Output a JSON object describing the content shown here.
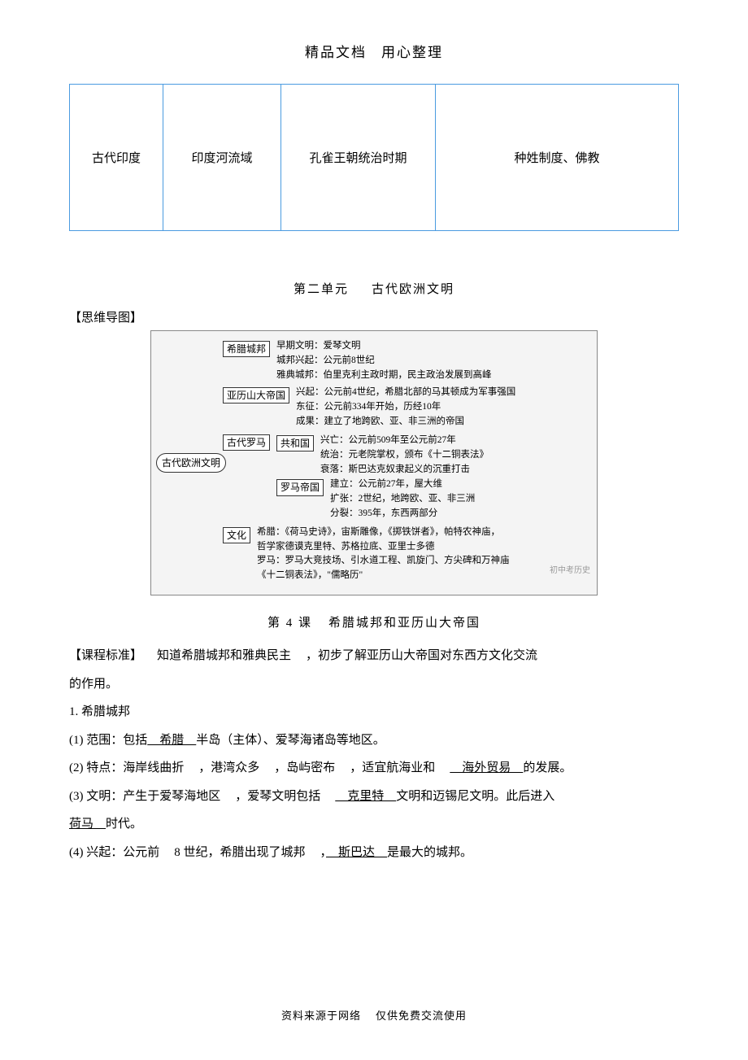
{
  "header": {
    "left": "精品文档",
    "right": "用心整理"
  },
  "table": {
    "row": {
      "c1": "古代印度",
      "c2": "印度河流域",
      "c3": "孔雀王朝统治时期",
      "c4": "种姓制度、佛教"
    }
  },
  "unit2": {
    "title_left": "第二单元",
    "title_right": "古代欧洲文明",
    "mindmap_label": "【思维导图】"
  },
  "mindmap": {
    "root": "古代欧洲文明",
    "greek": {
      "node": "希腊城邦",
      "l1": "早期文明：爱琴文明",
      "l2": "城邦兴起：公元前8世纪",
      "l3": "雅典城邦：伯里克利主政时期，民主政治发展到高峰"
    },
    "alex": {
      "node": "亚历山大帝国",
      "l1": "兴起：公元前4世纪，希腊北部的马其顿成为军事强国",
      "l2": "东征：公元前334年开始，历经10年",
      "l3": "成果：建立了地跨欧、亚、非三洲的帝国"
    },
    "rome": {
      "node": "古代罗马",
      "rep": {
        "node": "共和国",
        "l1": "兴亡：公元前509年至公元前27年",
        "l2": "统治：元老院掌权，颁布《十二铜表法》",
        "l3": "衰落：斯巴达克奴隶起义的沉重打击"
      },
      "emp": {
        "node": "罗马帝国",
        "l1": "建立：公元前27年，屋大维",
        "l2": "扩张：2世纪，地跨欧、亚、非三洲",
        "l3": "分裂：395年，东西两部分"
      }
    },
    "culture": {
      "node": "文化",
      "l1": "希腊：《荷马史诗》，宙斯雕像，《掷铁饼者》，帕特农神庙，",
      "l2": "哲学家德谟克里特、苏格拉底、亚里士多德",
      "l3": "罗马：罗马大竞技场、引水道工程、凯旋门、方尖碑和万神庙",
      "l4": "《十二铜表法》，\"儒略历\""
    },
    "watermark": "初中考历史"
  },
  "lesson4": {
    "title_left": "第 4 课",
    "title_right": "希腊城邦和亚历山大帝国",
    "std_label": "【课程标准】",
    "std_text1": "知道希腊城邦和雅典民主",
    "std_text2": "，初步了解亚历山大帝国对东西方文化交流",
    "std_text3": "的作用。",
    "p1_label": "1. 希腊城邦",
    "p1_1a": "(1) 范围：包括",
    "p1_1u": "　希腊　",
    "p1_1b": "半岛（主体）、爱琴海诸岛等地区。",
    "p1_2a": "(2) 特点：海岸线曲折",
    "p1_2b": "，港湾众多",
    "p1_2c": "，岛屿密布",
    "p1_2d": "，适宜航海业和",
    "p1_2u": "　海外贸易　",
    "p1_2e": "的发展。",
    "p1_3a": "(3) 文明：产生于爱琴海地区",
    "p1_3b": "，爱琴文明包括",
    "p1_3u": "　克里特　",
    "p1_3c": "文明和迈锡尼文明。此后进入",
    "p1_3u2": "荷马　",
    "p1_3d": "时代。",
    "p1_4a": "(4) 兴起：公元前",
    "p1_4b": "8 世纪，希腊出现了城邦",
    "p1_4c": "，",
    "p1_4u": "　斯巴达　",
    "p1_4d": "是最大的城邦。"
  },
  "footer": {
    "left": "资料来源于网络",
    "right": "仅供免费交流使用"
  }
}
